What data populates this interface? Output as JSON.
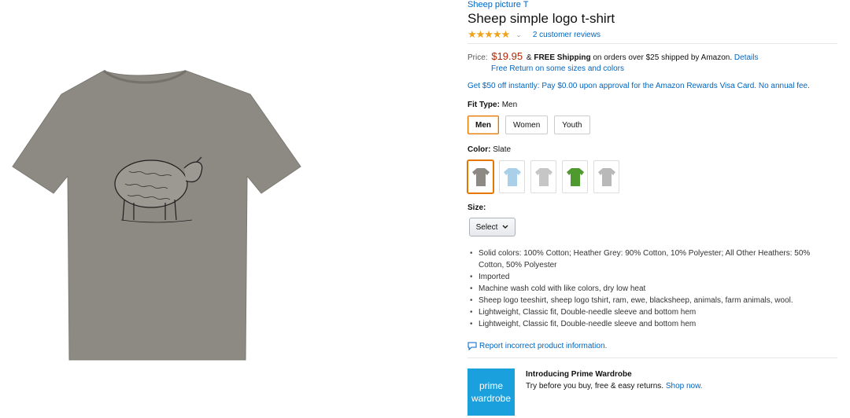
{
  "product": {
    "brand": "Sheep picture T",
    "title": "Sheep simple logo t-shirt",
    "stars": "★★★★★",
    "reviews": "2 customer reviews"
  },
  "price": {
    "label": "Price:",
    "value": "$19.95",
    "amp": "&",
    "free_shipping": "FREE Shipping",
    "shipping_text": "on orders over $25 shipped by Amazon.",
    "details_link": "Details",
    "free_return": "Free Return on some sizes and colors"
  },
  "promo": "Get $50 off instantly: Pay $0.00 upon approval for the Amazon Rewards Visa Card. No annual fee.",
  "fit_type": {
    "label": "Fit Type:",
    "value": "Men",
    "options": [
      "Men",
      "Women",
      "Youth"
    ]
  },
  "color": {
    "label": "Color:",
    "value": "Slate",
    "swatches": [
      "#8d8a83",
      "#a9cfe9",
      "#c6c6c6",
      "#4f9a2e",
      "#b9b9b9"
    ]
  },
  "size": {
    "label": "Size:",
    "select_label": "Select"
  },
  "bullets": [
    "Solid colors: 100% Cotton; Heather Grey: 90% Cotton, 10% Polyester; All Other Heathers: 50% Cotton, 50% Polyester",
    "Imported",
    "Machine wash cold with like colors, dry low heat",
    "Sheep logo teeshirt, sheep logo tshirt, ram, ewe, blacksheep, animals, farm animals, wool.",
    "Lightweight, Classic fit, Double-needle sleeve and bottom hem",
    "Lightweight, Classic fit, Double-needle sleeve and bottom hem"
  ],
  "report_link": "Report incorrect product information.",
  "prime": {
    "logo_line1": "prime",
    "logo_line2": "wardrobe",
    "title": "Introducing Prime Wardrobe",
    "desc": "Try before you buy, free & easy returns.",
    "link": "Shop now."
  },
  "colors": {
    "link": "#0066c0",
    "price": "#b12704",
    "selected_border": "#e77600",
    "prime_blue": "#1aa0dc",
    "shirt": "#8d8a83"
  },
  "icons": {
    "rating_chevron": "chevron-down-icon",
    "select_chevron": "chevron-down-icon",
    "report": "comment-icon"
  }
}
